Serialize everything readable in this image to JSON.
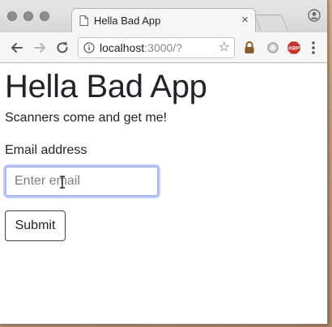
{
  "browser": {
    "tab": {
      "title": "Hella Bad App",
      "close_glyph": "×"
    },
    "address": {
      "host": "localhost",
      "rest": ":3000/?"
    },
    "icons": {
      "back": "back-arrow-icon",
      "forward": "forward-arrow-icon",
      "reload": "reload-icon",
      "info": "info-icon",
      "star": "star-icon",
      "lock_extension": "lock-icon",
      "circle_extension": "circle-extension-icon",
      "adblock": "adblock-plus-icon",
      "menu": "kebab-menu-icon",
      "profile": "profile-icon"
    },
    "star_glyph": "☆"
  },
  "page": {
    "title": "Hella Bad App",
    "tagline": "Scanners come and get me!",
    "form": {
      "email_label": "Email address",
      "email_placeholder": "Enter email",
      "email_value": "",
      "submit_label": "Submit"
    }
  },
  "colors": {
    "text": "#212529",
    "focus_ring": "#a9b8f0",
    "adblock_red": "#c9302c"
  }
}
